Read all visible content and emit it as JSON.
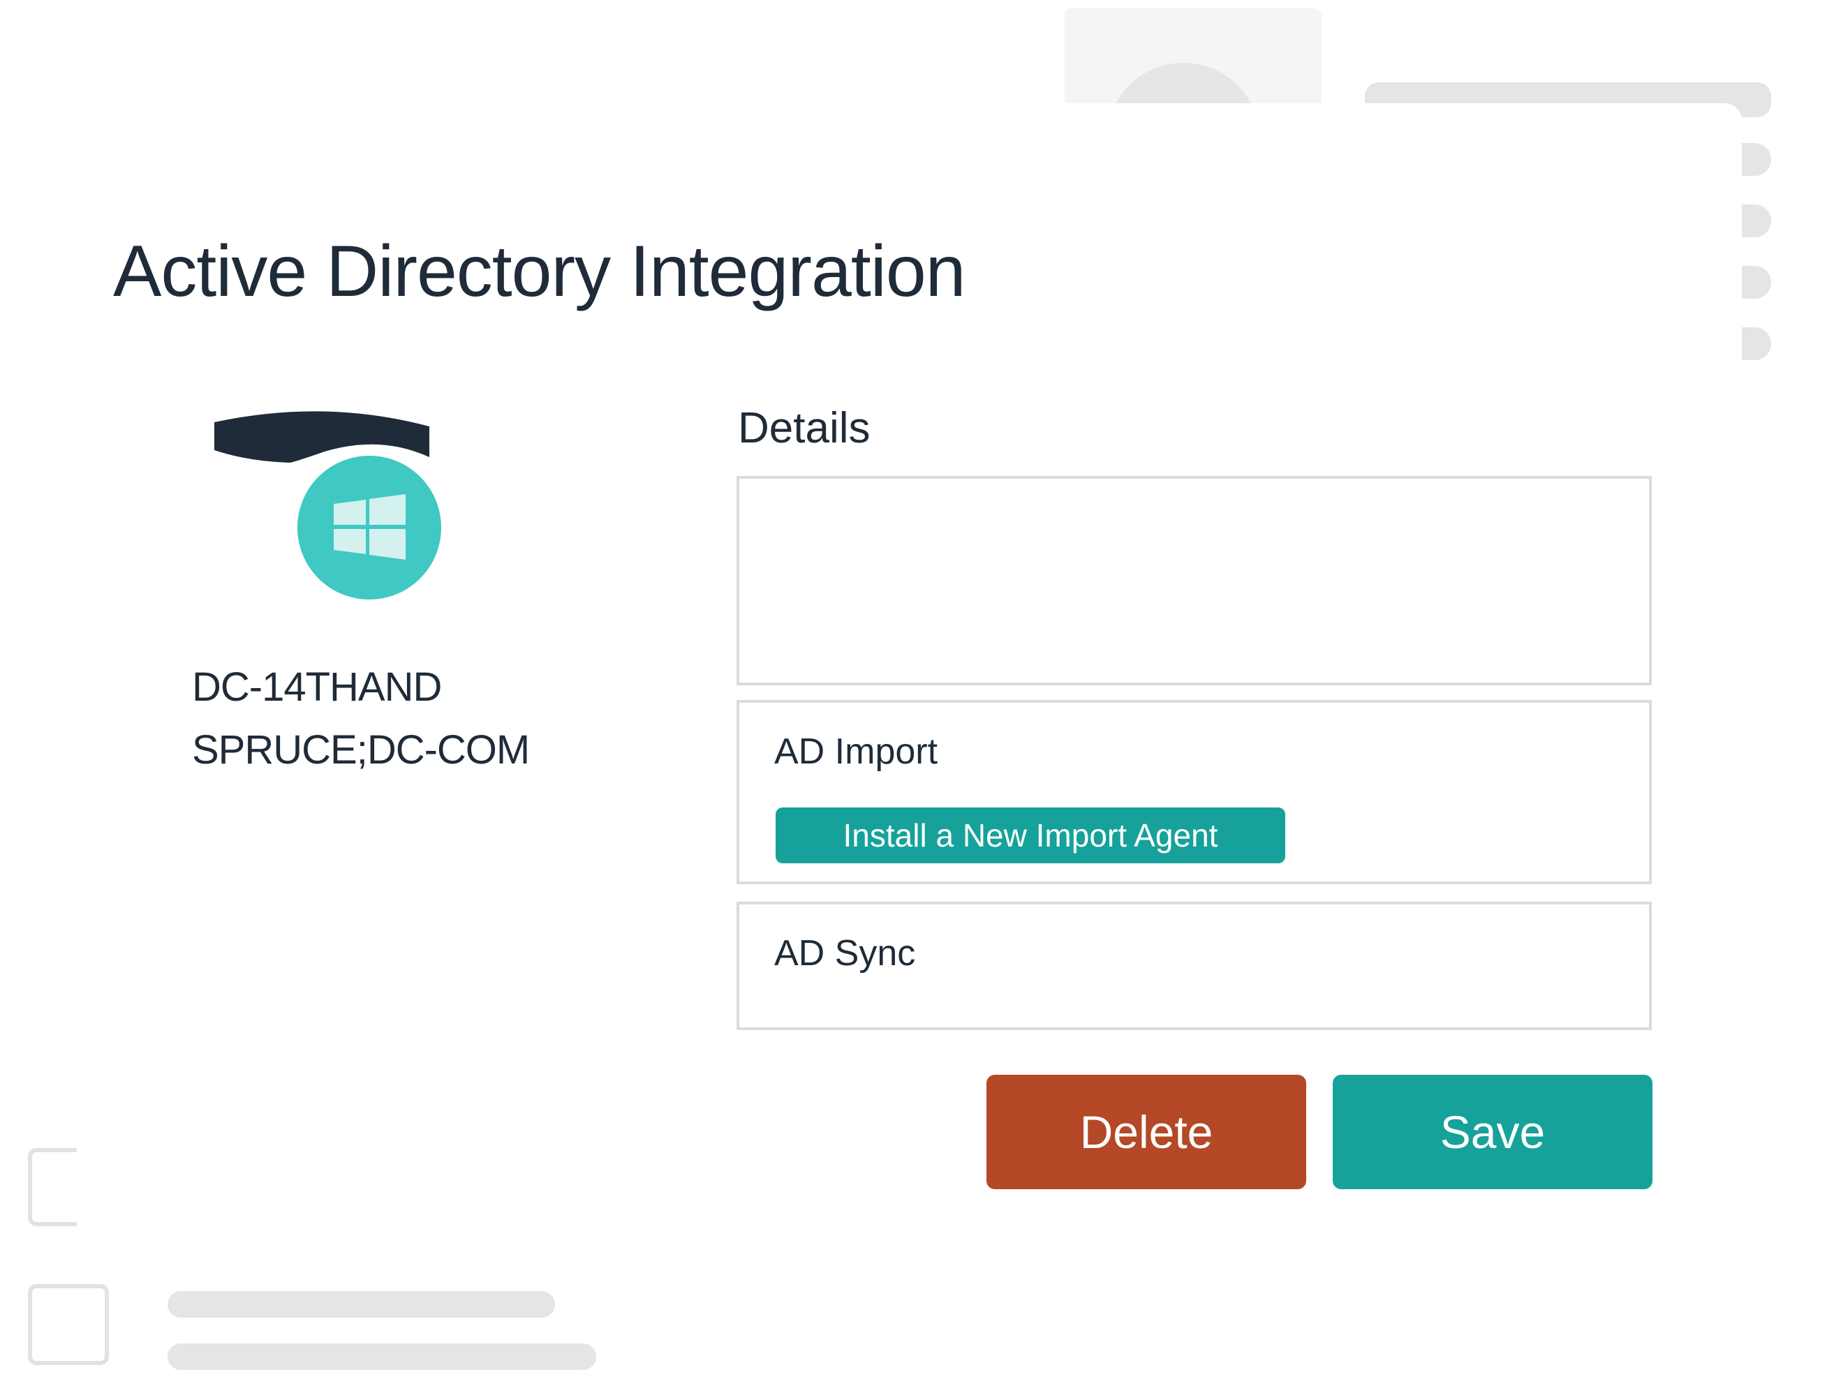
{
  "modal": {
    "title": "Active Directory Integration"
  },
  "server": {
    "icon": "windows-server-icon",
    "name_line1": "DC-14THAND",
    "name_line2": "SPRUCE;DC-COM"
  },
  "details": {
    "label": "Details"
  },
  "ad_import": {
    "title": "AD Import",
    "install_label": "Install a New Import Agent"
  },
  "ad_sync": {
    "title": "AD Sync"
  },
  "actions": {
    "delete_label": "Delete",
    "save_label": "Save"
  },
  "colors": {
    "primary": "#16a29a",
    "danger": "#b54826",
    "text": "#1f2b38",
    "icon_accent": "#40c8c2",
    "border": "#d9dbdd"
  }
}
